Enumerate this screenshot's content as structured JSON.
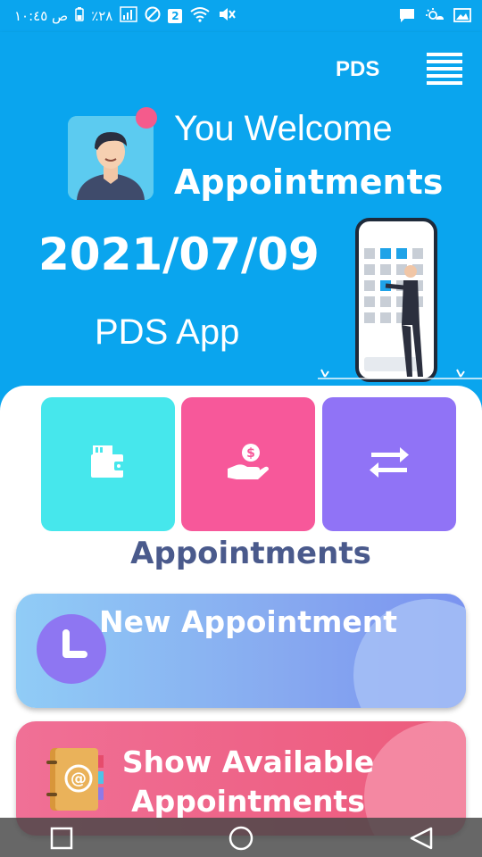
{
  "status_bar": {
    "left_text": "ص ١٠:٤٥",
    "battery_text": "٪٢٨",
    "sim_number": "2"
  },
  "app_bar": {
    "title": "PDS",
    "menu_icon": "hamburger-icon"
  },
  "hero": {
    "welcome": "You Welcome",
    "subtitle": "Appointments",
    "date": "2021/07/09",
    "app_name": "PDS App"
  },
  "tiles": [
    {
      "icon": "wallet-icon",
      "color": "#46e7ec"
    },
    {
      "icon": "hand-money-icon",
      "color": "#f7589a"
    },
    {
      "icon": "transfer-arrows-icon",
      "color": "#9073f6"
    }
  ],
  "section": {
    "title": "Appointments"
  },
  "cards": {
    "new": {
      "label": "New Appointment",
      "icon": "clock-icon"
    },
    "show": {
      "label_line1": "Show Available",
      "label_line2": "Appointments",
      "icon": "address-book-icon"
    }
  },
  "nav": {
    "buttons": [
      "recent-apps",
      "home",
      "back"
    ]
  },
  "colors": {
    "primary": "#0aa5ee",
    "section_title": "#4a5a8c"
  }
}
